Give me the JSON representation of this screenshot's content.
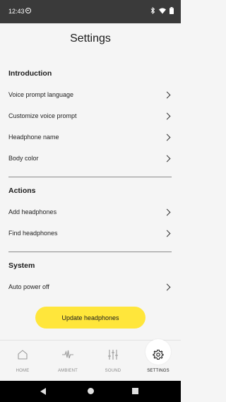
{
  "status_bar": {
    "time": "12:43",
    "icons": [
      "do-not-disturb-icon",
      "bluetooth-icon",
      "wifi-icon",
      "battery-icon"
    ]
  },
  "header": {
    "title": "Settings"
  },
  "sections": {
    "introduction": {
      "heading": "Introduction",
      "items": [
        {
          "label": "Voice prompt language"
        },
        {
          "label": "Customize voice prompt"
        },
        {
          "label": "Headphone name"
        },
        {
          "label": "Body color"
        }
      ]
    },
    "actions": {
      "heading": "Actions",
      "items": [
        {
          "label": "Add headphones"
        },
        {
          "label": "Find headphones"
        }
      ]
    },
    "system": {
      "heading": "System",
      "items": [
        {
          "label": "Auto power off"
        }
      ]
    }
  },
  "update_button": {
    "label": "Update headphones",
    "color": "#ffe63b"
  },
  "bottom_nav": {
    "items": [
      {
        "label": "HOME",
        "icon": "home-icon",
        "active": false
      },
      {
        "label": "AMBIENT",
        "icon": "waveform-icon",
        "active": false
      },
      {
        "label": "SOUND",
        "icon": "equalizer-icon",
        "active": false
      },
      {
        "label": "SETTINGS",
        "icon": "gear-icon",
        "active": true
      }
    ]
  }
}
